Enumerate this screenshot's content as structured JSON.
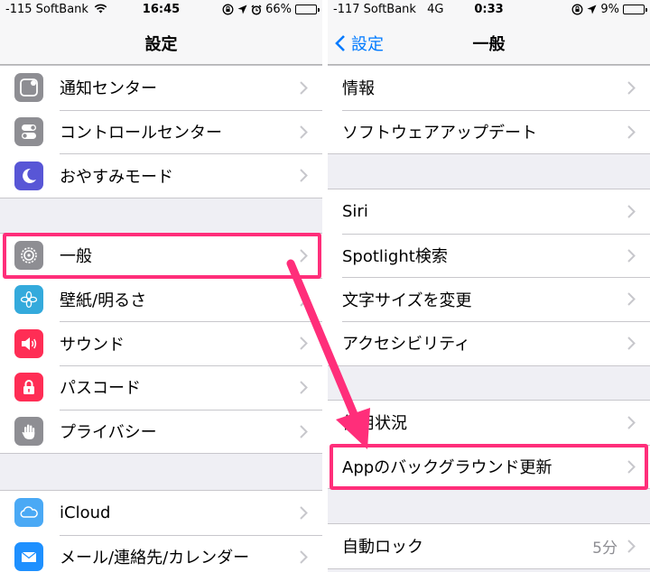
{
  "left": {
    "status": {
      "carrier": "-115 SoftBank",
      "time": "16:45",
      "battery": "66%",
      "battery_level": 0.66
    },
    "nav": {
      "title": "設定"
    },
    "groups": [
      [
        {
          "label": "通知センター",
          "icon": "notification-center-icon",
          "color": "#8e8e93"
        },
        {
          "label": "コントロールセンター",
          "icon": "control-center-icon",
          "color": "#8e8e93"
        },
        {
          "label": "おやすみモード",
          "icon": "moon-icon",
          "color": "#5856d6"
        }
      ],
      [
        {
          "label": "一般",
          "icon": "gear-icon",
          "color": "#8e8e93"
        },
        {
          "label": "壁紙/明るさ",
          "icon": "wallpaper-flower-icon",
          "color": "#34aadc"
        },
        {
          "label": "サウンド",
          "icon": "speaker-icon",
          "color": "#ff2d55"
        },
        {
          "label": "パスコード",
          "icon": "lock-icon",
          "color": "#ff2d55"
        },
        {
          "label": "プライバシー",
          "icon": "hand-icon",
          "color": "#8e8e93"
        }
      ],
      [
        {
          "label": "iCloud",
          "icon": "cloud-icon",
          "color": "#4aa9f5"
        },
        {
          "label": "メール/連絡先/カレンダー",
          "icon": "mail-icon",
          "color": "#1e90ff"
        }
      ]
    ]
  },
  "right": {
    "status": {
      "carrier": "-117 SoftBank",
      "network": "4G",
      "time": "0:33",
      "battery": "9%",
      "battery_level": 0.09
    },
    "nav": {
      "back": "設定",
      "title": "一般"
    },
    "groups": [
      [
        {
          "label": "情報"
        },
        {
          "label": "ソフトウェアアップデート"
        }
      ],
      [
        {
          "label": "Siri"
        },
        {
          "label": "Spotlight検索"
        },
        {
          "label": "文字サイズを変更"
        },
        {
          "label": "アクセシビリティ"
        }
      ],
      [
        {
          "label": "使用状況"
        },
        {
          "label": "Appのバックグラウンド更新"
        }
      ],
      [
        {
          "label": "自動ロック",
          "detail": "5分"
        }
      ]
    ]
  },
  "colors": {
    "highlight": "#ff2e7a",
    "accent": "#007aff"
  }
}
